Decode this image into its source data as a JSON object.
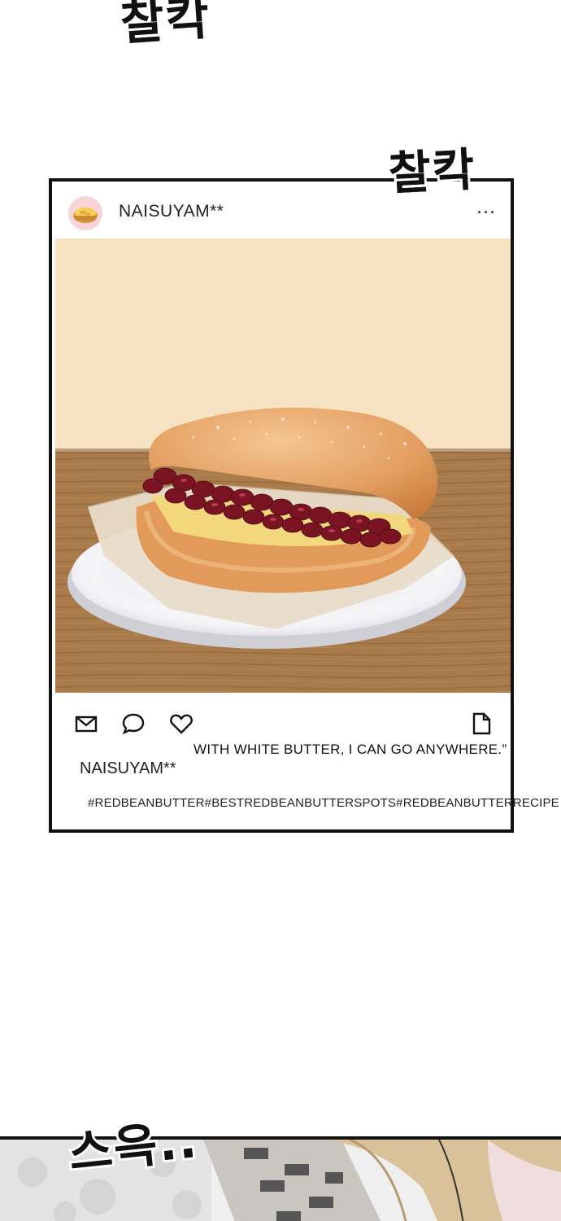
{
  "sfx": {
    "top": "찰칵",
    "right": "찰칵",
    "bottom": "스윽.."
  },
  "post": {
    "username": "NAISUYAM**",
    "more_label": "...",
    "caption_text": "WITH WHITE BUTTER, I CAN GO ANYWHERE.”",
    "caption_username": "NAISUYAM**",
    "hashtags": [
      "#REDBEANBUTTER",
      "#BESTREDBEANBUTTERSPOTS",
      "#REDBEANBUTTERRECIPE"
    ],
    "icons": [
      "mail-icon",
      "comment-icon",
      "heart-icon",
      "document-icon"
    ]
  },
  "colors": {
    "wall": "#f7e3c2",
    "table": "#a97a4a",
    "bun": "#e4a266",
    "beans": "#7a1422",
    "frame": "#111111"
  }
}
